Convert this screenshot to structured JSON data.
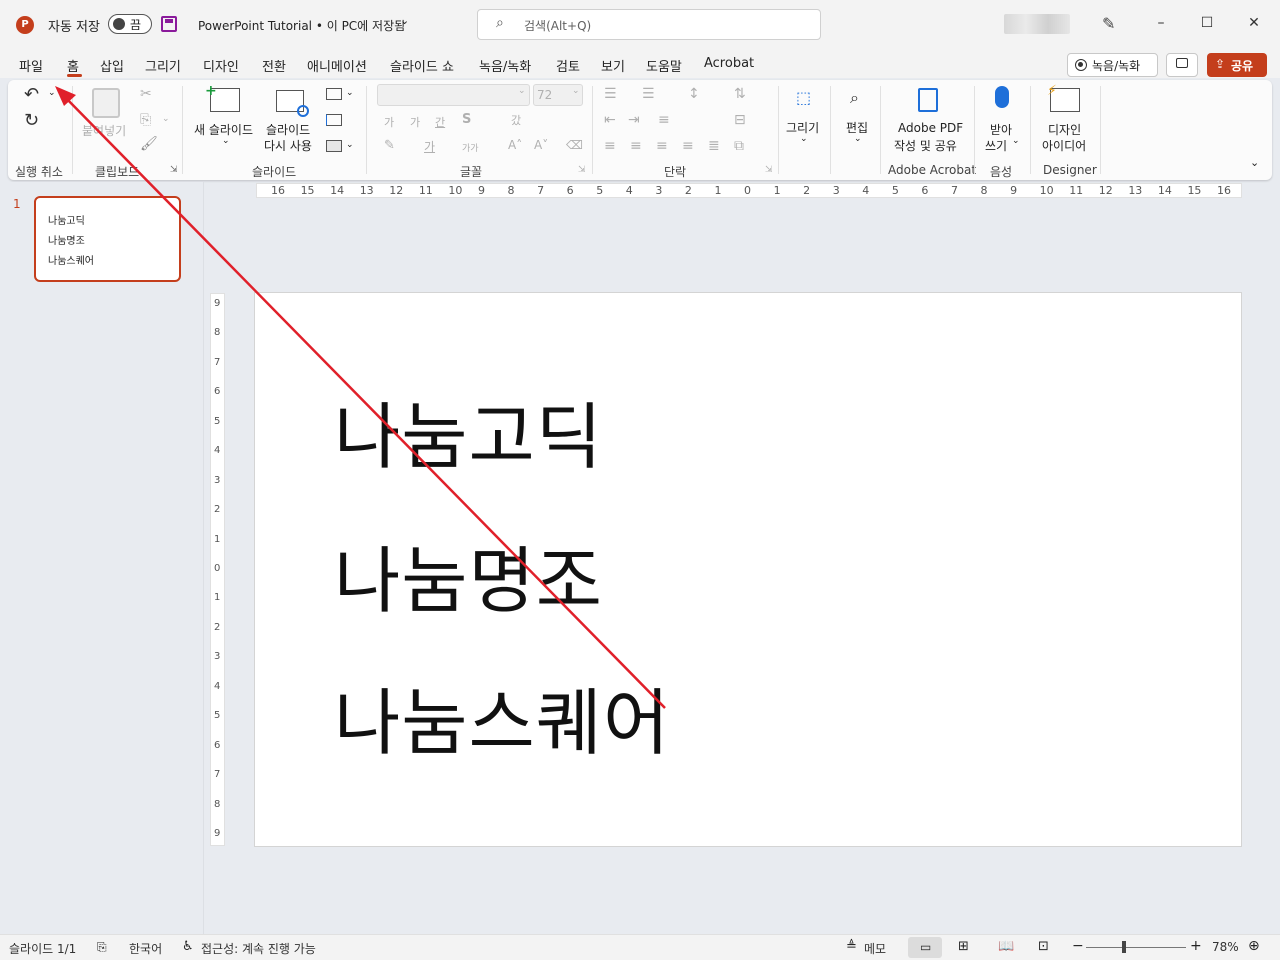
{
  "title_bar": {
    "autosave_label": "자동 저장",
    "autosave_state": "끔",
    "doc_title": "PowerPoint Tutorial • 이 PC에 저장됨",
    "search_placeholder": "검색(Alt+Q)"
  },
  "menu": {
    "items": [
      "파일",
      "홈",
      "삽입",
      "그리기",
      "디자인",
      "전환",
      "애니메이션",
      "슬라이드 쇼",
      "녹음/녹화",
      "검토",
      "보기",
      "도움말",
      "Acrobat"
    ],
    "record_button": "녹음/녹화",
    "share_button": "공유"
  },
  "ribbon": {
    "groups": {
      "undo": "실행 취소",
      "clipboard": "클립보드",
      "slides": "슬라이드",
      "font": "글꼴",
      "paragraph": "단락",
      "adobe": "Adobe Acrobat",
      "voice": "음성",
      "designer": "Designer"
    },
    "paste": "붙여넣기",
    "new_slide": "새 슬라이드",
    "reuse_slide_1": "슬라이드",
    "reuse_slide_2": "다시 사용",
    "font_size": "72",
    "draw": "그리기",
    "edit": "편집",
    "adobe_pdf_1": "Adobe PDF",
    "adobe_pdf_2": "작성 및 공유",
    "dictate_1": "받아",
    "dictate_2": "쓰기",
    "designer_1": "디자인",
    "designer_2": "아이디어",
    "font_btns": [
      "가",
      "가",
      "간",
      "S",
      "갔"
    ],
    "font_btns2": [
      "가",
      "가가"
    ]
  },
  "thumbnail": {
    "number": "1",
    "lines": [
      "나눔고딕",
      "나눔명조",
      "나눔스퀘어"
    ]
  },
  "slide": {
    "lines": [
      "나눔고딕",
      "나눔명조",
      "나눔스퀘어"
    ]
  },
  "ruler_h": [
    "16",
    "15",
    "14",
    "13",
    "12",
    "11",
    "10",
    "9",
    "8",
    "7",
    "6",
    "5",
    "4",
    "3",
    "2",
    "1",
    "0",
    "1",
    "2",
    "3",
    "4",
    "5",
    "6",
    "7",
    "8",
    "9",
    "10",
    "11",
    "12",
    "13",
    "14",
    "15",
    "16"
  ],
  "ruler_v": [
    "9",
    "8",
    "7",
    "6",
    "5",
    "4",
    "3",
    "2",
    "1",
    "0",
    "1",
    "2",
    "3",
    "4",
    "5",
    "6",
    "7",
    "8",
    "9"
  ],
  "status": {
    "slide_count": "슬라이드 1/1",
    "language": "한국어",
    "accessibility": "접근성: 계속 진행 가능",
    "notes": "메모",
    "zoom": "78%"
  },
  "colors": {
    "accent": "#c43e1c",
    "annotation_arrow": "#e0202a"
  }
}
